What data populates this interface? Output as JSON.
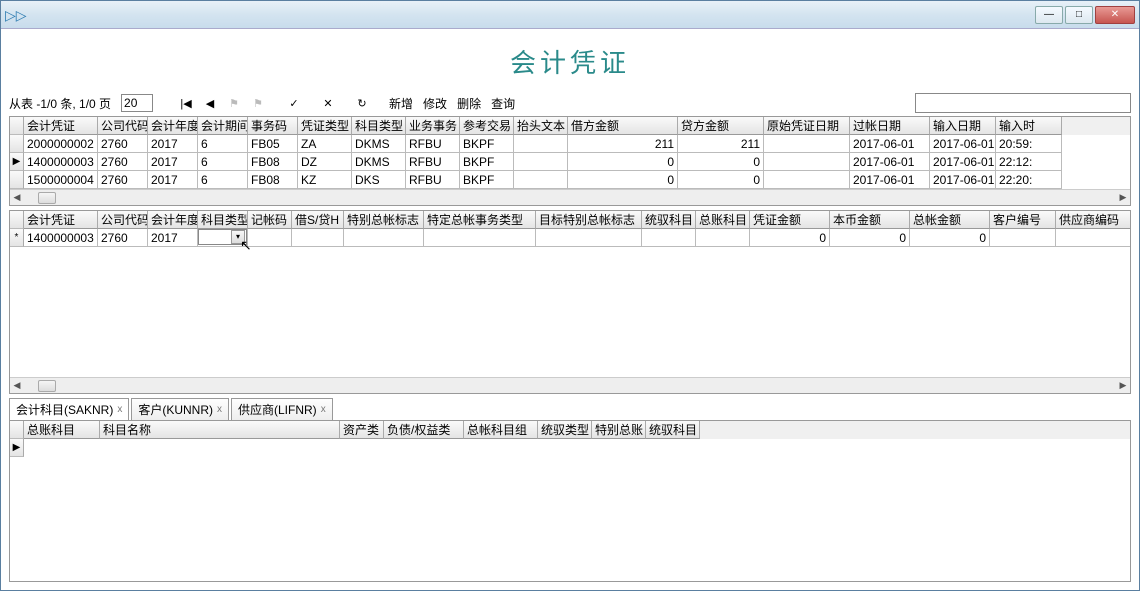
{
  "window": {
    "title": "会计凭证",
    "minimize": "—",
    "maximize": "□",
    "close": "✕"
  },
  "toolbar": {
    "status": "从表 -1/0 条, 1/0 页",
    "page_value": "20",
    "first": "|◀",
    "prev": "◀",
    "flag1": "⚑",
    "flag2": "⚑",
    "check": "✓",
    "cancel": "✕",
    "refresh": "↻",
    "add": "新增",
    "edit": "修改",
    "delete": "删除",
    "query": "查询"
  },
  "grid1": {
    "headers": [
      "会计凭证",
      "公司代码",
      "会计年度",
      "会计期间",
      "事务码",
      "凭证类型",
      "科目类型",
      "业务事务",
      "参考交易",
      "抬头文本",
      "借方金额",
      "贷方金额",
      "原始凭证日期",
      "过帐日期",
      "输入日期",
      "输入时"
    ],
    "rows": [
      {
        "h": "",
        "c": [
          "2000000002",
          "2760",
          "2017",
          "6",
          "FB05",
          "ZA",
          "DKMS",
          "RFBU",
          "BKPF",
          "",
          "211",
          "211",
          "",
          "2017-06-01",
          "2017-06-01",
          "20:59:"
        ]
      },
      {
        "h": "▶",
        "c": [
          "1400000003",
          "2760",
          "2017",
          "6",
          "FB08",
          "DZ",
          "DKMS",
          "RFBU",
          "BKPF",
          "",
          "0",
          "0",
          "",
          "2017-06-01",
          "2017-06-01",
          "22:12:"
        ]
      },
      {
        "h": "",
        "c": [
          "1500000004",
          "2760",
          "2017",
          "6",
          "FB08",
          "KZ",
          "DKS",
          "RFBU",
          "BKPF",
          "",
          "0",
          "0",
          "",
          "2017-06-01",
          "2017-06-01",
          "22:20:"
        ]
      }
    ]
  },
  "grid2": {
    "headers": [
      "会计凭证",
      "公司代码",
      "会计年度",
      "科目类型",
      "记帐码",
      "借S/贷H",
      "特别总帐标志",
      "特定总帐事务类型",
      "目标特别总帐标志",
      "统驭科目",
      "总账科目",
      "凭证金额",
      "本币金额",
      "总帐金额",
      "客户编号",
      "供应商编码"
    ],
    "row": {
      "h": "*",
      "c": [
        "1400000003",
        "2760",
        "2017",
        "",
        "",
        "",
        "",
        "",
        "",
        "",
        "",
        "0",
        "0",
        "0",
        "",
        ""
      ]
    }
  },
  "tabs": [
    {
      "label": "会计科目(SAKNR)",
      "active": true
    },
    {
      "label": "客户(KUNNR)",
      "active": false
    },
    {
      "label": "供应商(LIFNR)",
      "active": false
    }
  ],
  "grid3": {
    "headers": [
      "总账科目",
      "科目名称",
      "资产类",
      "负债/权益类",
      "总帐科目组",
      "统驭类型",
      "特别总账",
      "统驭科目"
    ]
  },
  "tab_close": "x",
  "widths": {
    "g1": [
      74,
      50,
      50,
      50,
      50,
      54,
      54,
      54,
      54,
      54,
      110,
      86,
      86,
      80,
      66,
      66,
      46
    ],
    "g2": [
      74,
      50,
      50,
      50,
      44,
      52,
      80,
      112,
      106,
      54,
      54,
      80,
      80,
      80,
      66,
      80
    ],
    "g3": [
      76,
      240,
      44,
      80,
      74,
      54,
      54,
      54
    ]
  }
}
